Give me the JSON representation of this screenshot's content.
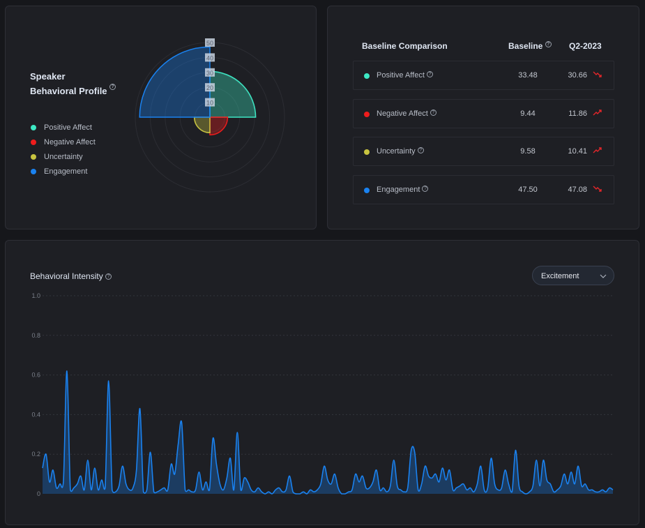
{
  "profile": {
    "title_line1": "Speaker",
    "title_line2": "Behavioral Profile",
    "help_icon": "question-circle-icon",
    "legend": [
      {
        "label": "Positive Affect",
        "color": "#3de8c4"
      },
      {
        "label": "Negative Affect",
        "color": "#ee1c1c"
      },
      {
        "label": "Uncertainty",
        "color": "#c8c440"
      },
      {
        "label": "Engagement",
        "color": "#1a82f0"
      }
    ],
    "radial_ticks": [
      "10",
      "20",
      "30",
      "40",
      "50"
    ],
    "radial_max": 50
  },
  "comparison": {
    "title": "Baseline Comparison",
    "col_baseline": "Baseline",
    "col_period": "Q2-2023",
    "rows": [
      {
        "label": "Positive Affect",
        "color": "#3de8c4",
        "baseline": "33.48",
        "period": "30.66",
        "trend": "down"
      },
      {
        "label": "Negative Affect",
        "color": "#ee1c1c",
        "baseline": "9.44",
        "period": "11.86",
        "trend": "up"
      },
      {
        "label": "Uncertainty",
        "color": "#c8c440",
        "baseline": "9.58",
        "period": "10.41",
        "trend": "up"
      },
      {
        "label": "Engagement",
        "color": "#1a82f0",
        "baseline": "47.50",
        "period": "47.08",
        "trend": "down"
      }
    ],
    "trend_color": "#e5262a"
  },
  "intensity": {
    "title": "Behavioral Intensity",
    "dropdown_value": "Excitement"
  },
  "chart_data": {
    "type": "area",
    "title": "Behavioral Intensity",
    "ylim": [
      0,
      1.0
    ],
    "y_ticks": [
      "0",
      "0.2",
      "0.4",
      "0.6",
      "0.8",
      "1.0"
    ],
    "grid": true,
    "color": "#1a82f0",
    "values": [
      0.13,
      0.2,
      0.06,
      0.12,
      0.03,
      0.05,
      0.06,
      0.62,
      0.02,
      0.03,
      0.05,
      0.09,
      0.02,
      0.17,
      0.02,
      0.13,
      0.02,
      0.07,
      0.03,
      0.57,
      0.02,
      0.01,
      0.04,
      0.14,
      0.05,
      0.02,
      0.03,
      0.12,
      0.43,
      0.01,
      0.02,
      0.21,
      0.01,
      0.01,
      0.02,
      0.03,
      0.02,
      0.15,
      0.1,
      0.25,
      0.36,
      0.02,
      0.02,
      0.01,
      0.02,
      0.11,
      0.02,
      0.06,
      0.02,
      0.28,
      0.15,
      0.05,
      0.02,
      0.08,
      0.18,
      0.02,
      0.31,
      0.02,
      0.08,
      0.06,
      0.02,
      0.01,
      0.03,
      0.01,
      0.0,
      0.01,
      0.0,
      0.02,
      0.03,
      0.01,
      0.02,
      0.09,
      0.01,
      0.0,
      0.0,
      0.01,
      0.0,
      0.02,
      0.01,
      0.02,
      0.05,
      0.14,
      0.07,
      0.05,
      0.1,
      0.03,
      0.0,
      0.0,
      0.01,
      0.02,
      0.1,
      0.06,
      0.09,
      0.03,
      0.03,
      0.06,
      0.12,
      0.02,
      0.03,
      0.01,
      0.04,
      0.17,
      0.04,
      0.02,
      0.01,
      0.03,
      0.22,
      0.21,
      0.02,
      0.05,
      0.14,
      0.09,
      0.08,
      0.1,
      0.06,
      0.13,
      0.07,
      0.12,
      0.02,
      0.03,
      0.04,
      0.05,
      0.02,
      0.03,
      0.01,
      0.05,
      0.14,
      0.02,
      0.03,
      0.18,
      0.05,
      0.02,
      0.03,
      0.12,
      0.05,
      0.01,
      0.22,
      0.04,
      0.01,
      0.0,
      0.01,
      0.04,
      0.17,
      0.04,
      0.17,
      0.07,
      0.05,
      0.01,
      0.02,
      0.04,
      0.1,
      0.05,
      0.11,
      0.05,
      0.14,
      0.04,
      0.05,
      0.02,
      0.02,
      0.01,
      0.01,
      0.02,
      0.01,
      0.03,
      0.02
    ]
  }
}
